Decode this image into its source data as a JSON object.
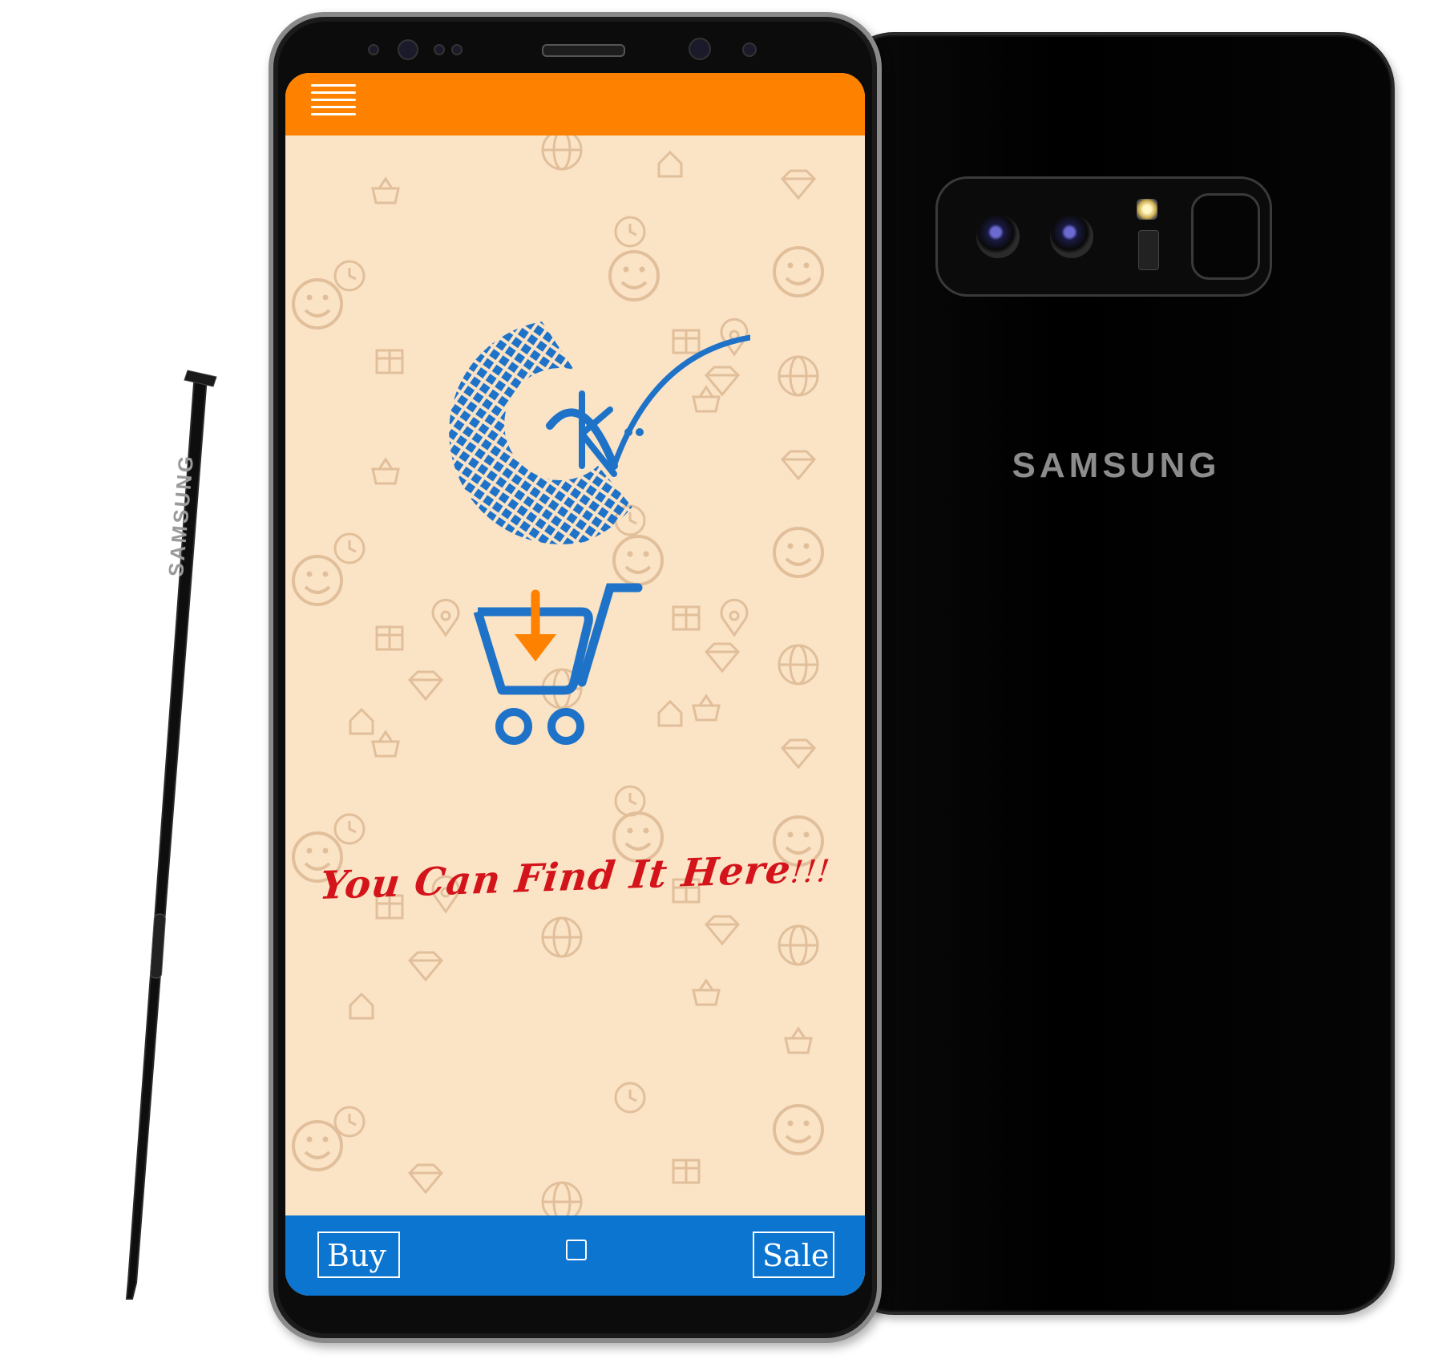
{
  "back_phone": {
    "brand": "SAMSUNG"
  },
  "pen": {
    "brand": "SAMSUNG"
  },
  "app": {
    "menu": {
      "icon": "hamburger-icon"
    },
    "logo": {
      "icon": "globe-check-logo"
    },
    "cart": {
      "icon": "cart-download-icon"
    },
    "tagline": "You Can Find It Here",
    "tagline_exclaim": "!!!",
    "bottom_bar": {
      "buy_label": "Buy",
      "sale_label": "Sale",
      "home_icon": "home-square-icon"
    }
  },
  "colors": {
    "topbar": "#fe8100",
    "bottombar": "#0b75d0",
    "screen_bg": "#fbe3c6",
    "logo_blue": "#1e73c8",
    "arrow_orange": "#fe8100",
    "tagline_red": "#d4141b"
  }
}
